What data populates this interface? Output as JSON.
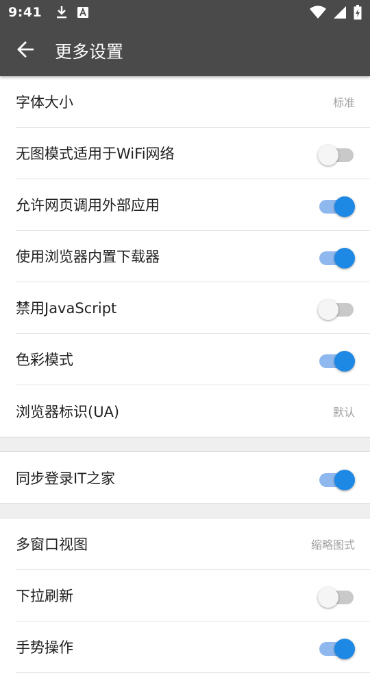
{
  "status_bar": {
    "time": "9:41",
    "icons_left": [
      "download-icon",
      "a-notification-icon"
    ],
    "icons_right": [
      "wifi-icon",
      "signal-icon",
      "battery-icon"
    ]
  },
  "app_bar": {
    "back_icon": "arrow-left-icon",
    "title": "更多设置"
  },
  "accent_color": "#1e88e5",
  "groups": [
    [
      {
        "label": "字体大小",
        "type": "value",
        "value": "标准"
      },
      {
        "label": "无图模式适用于WiFi网络",
        "type": "toggle",
        "on": false
      },
      {
        "label": "允许网页调用外部应用",
        "type": "toggle",
        "on": true
      },
      {
        "label": "使用浏览器内置下载器",
        "type": "toggle",
        "on": true
      },
      {
        "label": "禁用JavaScript",
        "type": "toggle",
        "on": false
      },
      {
        "label": "色彩模式",
        "type": "toggle",
        "on": true
      },
      {
        "label": "浏览器标识(UA)",
        "type": "value",
        "value": "默认"
      }
    ],
    [
      {
        "label": "同步登录IT之家",
        "type": "toggle",
        "on": true
      }
    ],
    [
      {
        "label": "多窗口视图",
        "type": "value",
        "value": "缩略图式"
      },
      {
        "label": "下拉刷新",
        "type": "toggle",
        "on": false
      },
      {
        "label": "手势操作",
        "type": "toggle",
        "on": true
      }
    ]
  ]
}
